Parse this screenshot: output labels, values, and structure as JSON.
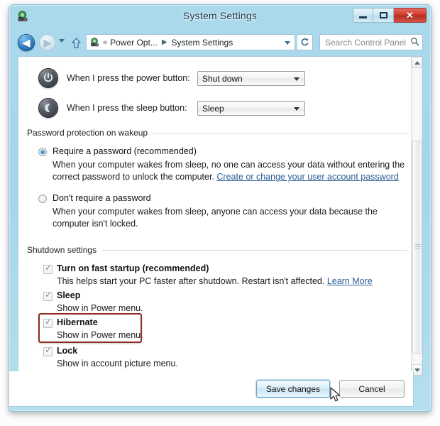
{
  "window": {
    "title": "System Settings",
    "app_icon": "power-options-icon",
    "controls": {
      "minimize": "minimize-button",
      "maximize": "maximize-button",
      "close_glyph": "✕"
    }
  },
  "navbar": {
    "back": "◀",
    "forward": "▶",
    "recent_dropdown": "recent-locations-chevron",
    "up": "⇧",
    "address": {
      "icon": "power-options-icon",
      "chevron": "«",
      "segments": [
        "Power Opt...",
        "System Settings"
      ],
      "separator": "▶",
      "dropdown": "address-dropdown-chevron"
    },
    "refresh": "↯",
    "search": {
      "placeholder": "Search Control Panel",
      "value": "",
      "icon": "search-icon"
    }
  },
  "main": {
    "button_rows": [
      {
        "icon": "power-button-icon",
        "label": "When I press the power button:",
        "value": "Shut down"
      },
      {
        "icon": "sleep-moon-icon",
        "label": "When I press the sleep button:",
        "value": "Sleep"
      }
    ],
    "password_group": {
      "label": "Password protection on wakeup",
      "options": [
        {
          "title": "Require a password (recommended)",
          "selected": true,
          "desc_line1": "When your computer wakes from sleep, no one can access your data without entering the",
          "desc_line2_text": "correct password to unlock the computer.",
          "desc_link": "Create or change your user account password"
        },
        {
          "title": "Don't require a password",
          "selected": false,
          "desc_line1": "When your computer wakes from sleep, anyone can access your data because the",
          "desc_line2_text": "computer isn't locked.",
          "desc_link": ""
        }
      ]
    },
    "shutdown_group": {
      "label": "Shutdown settings",
      "items": [
        {
          "title": "Turn on fast startup (recommended)",
          "checked": true,
          "desc": "This helps start your PC faster after shutdown. Restart isn't affected.",
          "link": "Learn More",
          "highlighted": false
        },
        {
          "title": "Sleep",
          "checked": true,
          "desc": "Show in Power menu.",
          "link": "",
          "highlighted": false
        },
        {
          "title": "Hibernate",
          "checked": true,
          "desc": "Show in Power menu.",
          "link": "",
          "highlighted": true
        },
        {
          "title": "Lock",
          "checked": true,
          "desc": "Show in account picture menu.",
          "link": "",
          "highlighted": false
        }
      ]
    }
  },
  "scrollbar": {
    "up_arrow": "▲",
    "down_arrow": "▼"
  },
  "footer": {
    "save_label": "Save changes",
    "cancel_label": "Cancel"
  },
  "annotation": {
    "color": "#8f2b22",
    "target": "Hibernate"
  }
}
